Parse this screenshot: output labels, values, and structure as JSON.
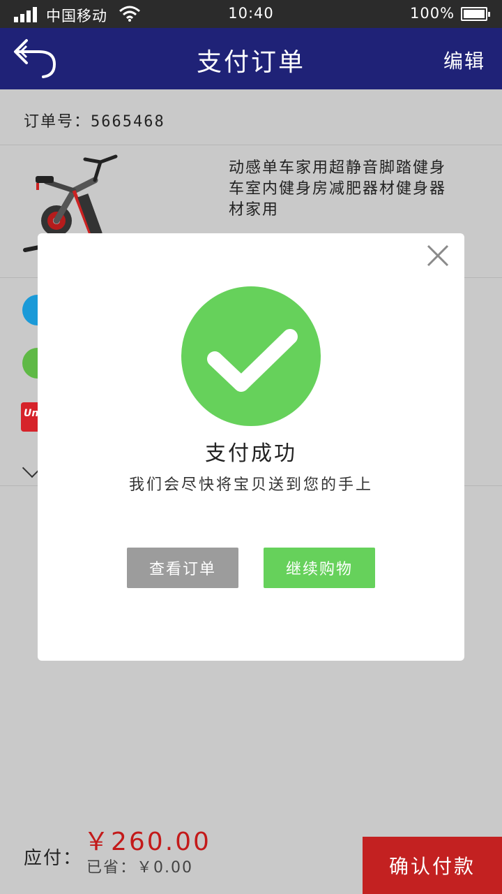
{
  "status_bar": {
    "carrier": "中国移动",
    "time": "10:40",
    "battery": "100%"
  },
  "nav": {
    "title": "支付订单",
    "edit_label": "编辑"
  },
  "order": {
    "label": "订单号：",
    "number": "5665468"
  },
  "product": {
    "description": "动感单车家用超静音脚踏健身车室内健身房减肥器材健身器材家用"
  },
  "bottom_bar": {
    "pay_label": "应付：",
    "amount": "￥260.00",
    "saved": "已省：￥0.00",
    "confirm_label": "确认付款"
  },
  "modal": {
    "title": "支付成功",
    "subtitle": "我们会尽快将宝贝送到您的手上",
    "view_order_label": "查看订单",
    "continue_label": "继续购物"
  },
  "colors": {
    "nav_bg": "#1f2277",
    "success_green": "#66d15b",
    "price_red": "#c31a1a",
    "confirm_red": "#c32121",
    "page_bg": "#c9c9c9"
  }
}
